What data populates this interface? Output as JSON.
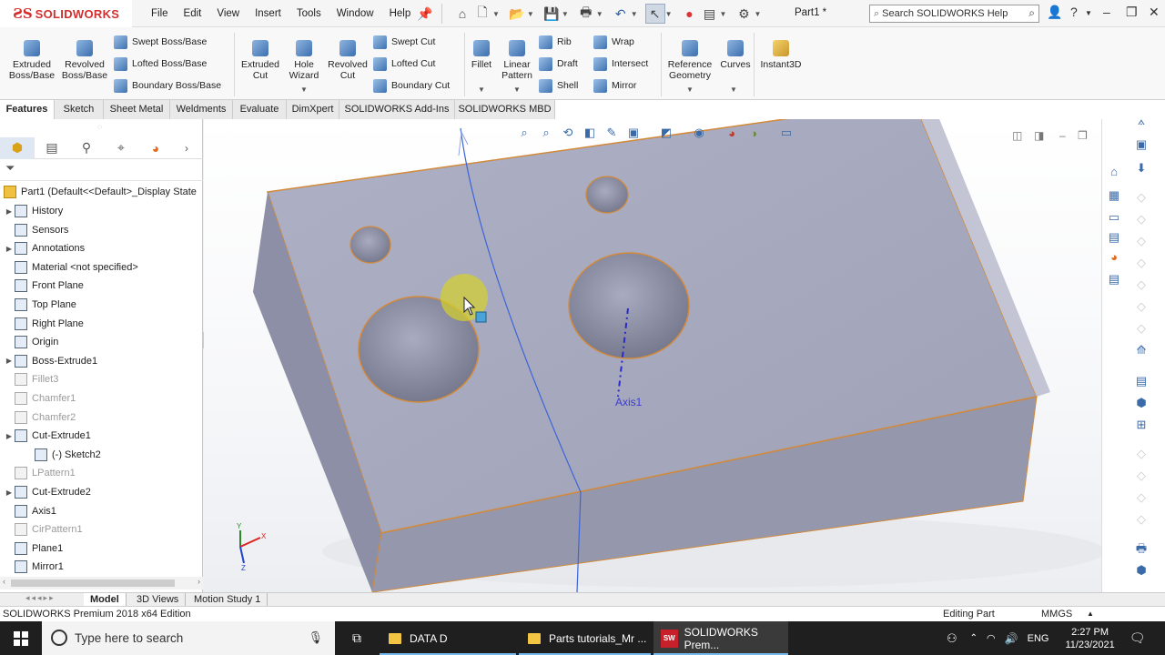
{
  "app": {
    "brand": "SOLIDWORKS",
    "doc_title": "Part1 *"
  },
  "menu": [
    "File",
    "Edit",
    "View",
    "Insert",
    "Tools",
    "Window",
    "Help"
  ],
  "search": {
    "placeholder": "Search SOLIDWORKS Help"
  },
  "ribbon": {
    "extruded_boss": "Extruded Boss/Base",
    "revolved_boss": "Revolved Boss/Base",
    "swept_boss": "Swept Boss/Base",
    "lofted_boss": "Lofted Boss/Base",
    "boundary_boss": "Boundary Boss/Base",
    "extruded_cut": "Extruded Cut",
    "hole_wizard": "Hole Wizard",
    "revolved_cut": "Revolved Cut",
    "swept_cut": "Swept Cut",
    "lofted_cut": "Lofted Cut",
    "boundary_cut": "Boundary Cut",
    "fillet": "Fillet",
    "linear_pattern": "Linear Pattern",
    "rib": "Rib",
    "draft": "Draft",
    "shell": "Shell",
    "wrap": "Wrap",
    "intersect": "Intersect",
    "mirror": "Mirror",
    "reference_geometry": "Reference Geometry",
    "curves": "Curves",
    "instant3d": "Instant3D"
  },
  "tabs": [
    "Features",
    "Sketch",
    "Sheet Metal",
    "Weldments",
    "Evaluate",
    "DimXpert",
    "SOLIDWORKS Add-Ins",
    "SOLIDWORKS MBD"
  ],
  "tree": {
    "root": "Part1  (Default<<Default>_Display State",
    "items": [
      {
        "label": "History",
        "dim": false,
        "exp": true
      },
      {
        "label": "Sensors",
        "dim": false,
        "exp": false
      },
      {
        "label": "Annotations",
        "dim": false,
        "exp": true
      },
      {
        "label": "Material <not specified>",
        "dim": false,
        "exp": false
      },
      {
        "label": "Front Plane",
        "dim": false,
        "exp": false
      },
      {
        "label": "Top Plane",
        "dim": false,
        "exp": false
      },
      {
        "label": "Right Plane",
        "dim": false,
        "exp": false
      },
      {
        "label": "Origin",
        "dim": false,
        "exp": false
      },
      {
        "label": "Boss-Extrude1",
        "dim": false,
        "exp": true
      },
      {
        "label": "Fillet3",
        "dim": true,
        "exp": false
      },
      {
        "label": "Chamfer1",
        "dim": true,
        "exp": false
      },
      {
        "label": "Chamfer2",
        "dim": true,
        "exp": false
      },
      {
        "label": "Cut-Extrude1",
        "dim": false,
        "exp": true
      },
      {
        "label": "(-) Sketch2",
        "dim": false,
        "exp": false
      },
      {
        "label": "LPattern1",
        "dim": true,
        "exp": false
      },
      {
        "label": "Cut-Extrude2",
        "dim": false,
        "exp": true
      },
      {
        "label": "Axis1",
        "dim": false,
        "exp": false
      },
      {
        "label": "CirPattern1",
        "dim": true,
        "exp": false
      },
      {
        "label": "Plane1",
        "dim": false,
        "exp": false
      },
      {
        "label": "Mirror1",
        "dim": false,
        "exp": false
      }
    ]
  },
  "viewport": {
    "axis_label": "Axis1"
  },
  "bottom_tabs": [
    "Model",
    "3D Views",
    "Motion Study 1"
  ],
  "status": {
    "edition": "SOLIDWORKS Premium 2018 x64 Edition",
    "mode": "Editing Part",
    "units": "MMGS"
  },
  "taskbar": {
    "search_placeholder": "Type here to search",
    "apps": [
      "DATA D",
      "Parts tutorials_Mr ...",
      "SOLIDWORKS Prem..."
    ],
    "lang": "ENG",
    "time": "2:27 PM",
    "date": "11/23/2021"
  }
}
